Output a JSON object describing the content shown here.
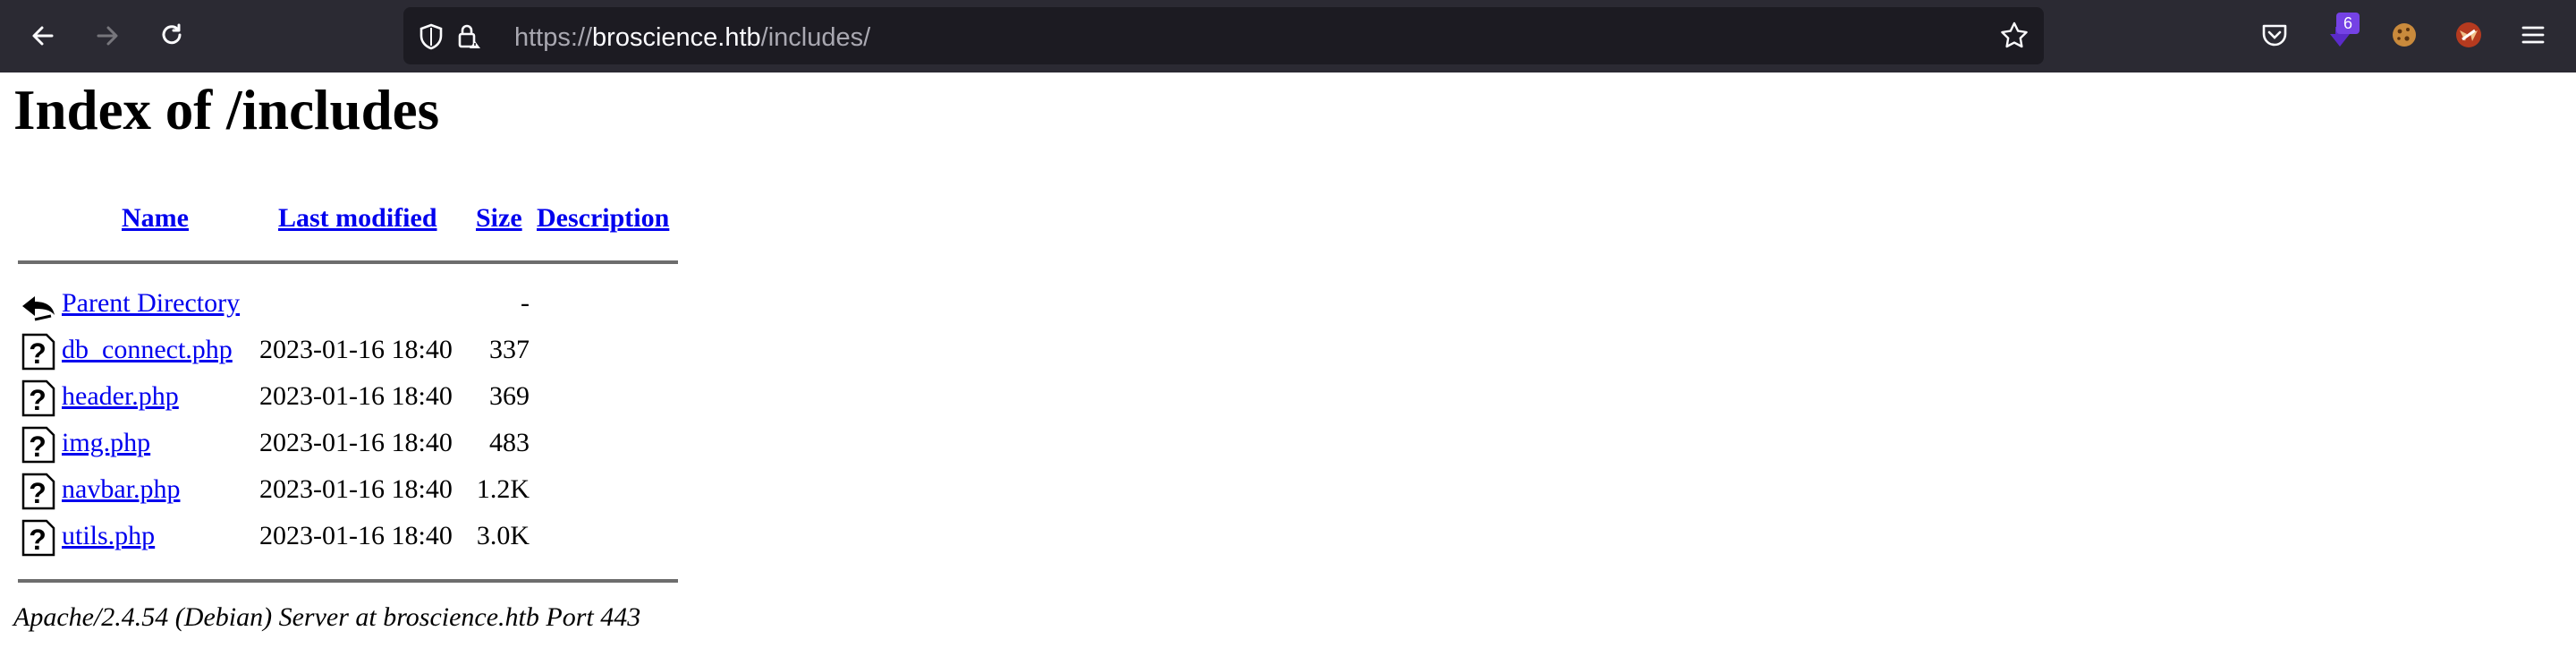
{
  "browser": {
    "url_scheme": "https://",
    "url_host": "broscience.htb",
    "url_path": "/includes/",
    "extension_badge": "6"
  },
  "page": {
    "title": "Index of /includes",
    "headers": {
      "name": "Name",
      "last_modified": "Last modified",
      "size": "Size",
      "description": "Description"
    },
    "rows": [
      {
        "name": "Parent Directory",
        "modified": "",
        "size": "-",
        "icon": "back-icon"
      },
      {
        "name": "db_connect.php",
        "modified": "2023-01-16 18:40",
        "size": "337",
        "icon": "unknown-file-icon"
      },
      {
        "name": "header.php",
        "modified": "2023-01-16 18:40",
        "size": "369",
        "icon": "unknown-file-icon"
      },
      {
        "name": "img.php",
        "modified": "2023-01-16 18:40",
        "size": "483",
        "icon": "unknown-file-icon"
      },
      {
        "name": "navbar.php",
        "modified": "2023-01-16 18:40",
        "size": "1.2K",
        "icon": "unknown-file-icon"
      },
      {
        "name": "utils.php",
        "modified": "2023-01-16 18:40",
        "size": "3.0K",
        "icon": "unknown-file-icon"
      }
    ],
    "footer": "Apache/2.4.54 (Debian) Server at broscience.htb Port 443"
  }
}
